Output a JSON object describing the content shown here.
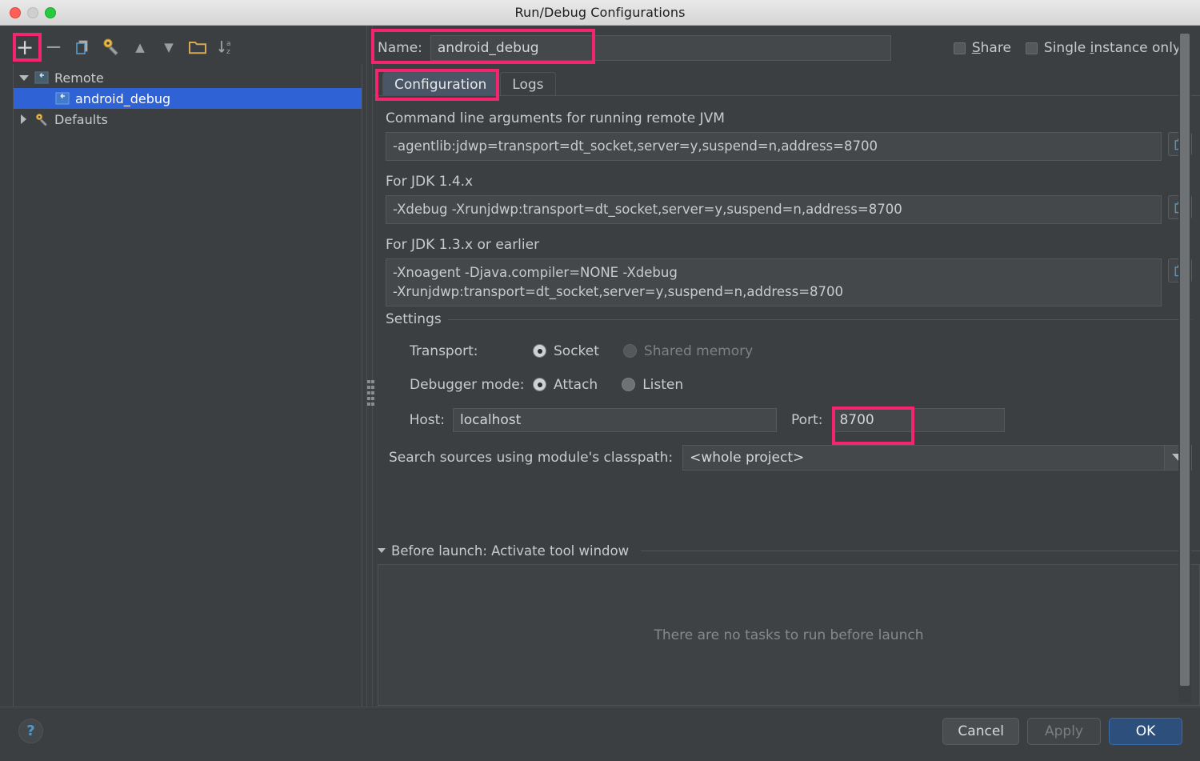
{
  "window": {
    "title": "Run/Debug Configurations",
    "traffic_lights": [
      "close-red",
      "minimize-yellow",
      "zoom-green"
    ]
  },
  "accents": {
    "highlight": "#f4246e",
    "selection": "#2f62d4",
    "primary_button": "#2d4f7c",
    "panel_bg": "#3c3f41",
    "input_bg": "#45484a"
  },
  "left_toolbar": {
    "buttons": [
      {
        "name": "add",
        "icon": "plus-icon",
        "glyph": "+",
        "highlighted": true
      },
      {
        "name": "remove",
        "icon": "minus-icon",
        "glyph": "−",
        "highlighted": false
      },
      {
        "name": "copy",
        "icon": "copy-icon",
        "glyph": "",
        "highlighted": false
      },
      {
        "name": "edit-defaults",
        "icon": "wrench-icon",
        "glyph": "",
        "highlighted": false
      },
      {
        "name": "move-up",
        "icon": "arrow-up-icon",
        "glyph": "▲",
        "highlighted": false
      },
      {
        "name": "move-down",
        "icon": "arrow-down-icon",
        "glyph": "▼",
        "highlighted": false
      },
      {
        "name": "new-folder",
        "icon": "folder-icon",
        "glyph": "",
        "highlighted": false
      },
      {
        "name": "sort-alphabetically",
        "icon": "sort-az-icon",
        "glyph": "",
        "highlighted": false
      }
    ]
  },
  "tree": {
    "nodes": [
      {
        "label": "Remote",
        "expander": "down",
        "icon": "remote-config-icon",
        "indent": false,
        "selected": false
      },
      {
        "label": "android_debug",
        "expander": "blank",
        "icon": "remote-config-icon",
        "indent": true,
        "selected": true
      },
      {
        "label": "Defaults",
        "expander": "right",
        "icon": "wrench-icon",
        "indent": false,
        "selected": false
      }
    ]
  },
  "name_row": {
    "label": "Name:",
    "value": "android_debug",
    "share": {
      "label_before": "",
      "underlined": "S",
      "label_after": "hare",
      "checked": false
    },
    "single_instance": {
      "label_before": "Single ",
      "underlined": "i",
      "label_after": "nstance only",
      "checked": false
    }
  },
  "tabs": [
    {
      "label": "Configuration",
      "active": true,
      "highlighted": true
    },
    {
      "label": "Logs",
      "active": false,
      "highlighted": false
    }
  ],
  "configuration": {
    "cmdline": {
      "label": "Command line arguments for running remote JVM",
      "value": "-agentlib:jdwp=transport=dt_socket,server=y,suspend=n,address=8700",
      "copy_icon": "copy-icon"
    },
    "jdk14": {
      "label": "For JDK 1.4.x",
      "value": "-Xdebug -Xrunjdwp:transport=dt_socket,server=y,suspend=n,address=8700",
      "copy_icon": "copy-icon"
    },
    "jdk13": {
      "label": "For JDK 1.3.x or earlier",
      "value": "-Xnoagent -Djava.compiler=NONE -Xdebug\n-Xrunjdwp:transport=dt_socket,server=y,suspend=n,address=8700",
      "copy_icon": "copy-icon"
    },
    "settings": {
      "legend": "Settings",
      "transport": {
        "label": "Transport:",
        "options": [
          {
            "label": "Socket",
            "selected": true,
            "disabled": false
          },
          {
            "label": "Shared memory",
            "selected": false,
            "disabled": true
          }
        ]
      },
      "debugger_mode": {
        "label": "Debugger mode:",
        "options": [
          {
            "label": "Attach",
            "selected": true,
            "disabled": false
          },
          {
            "label": "Listen",
            "selected": false,
            "disabled": false
          }
        ]
      },
      "host": {
        "label": "Host:",
        "value": "localhost"
      },
      "port": {
        "label": "Port:",
        "value": "8700",
        "highlighted": true
      },
      "search_sources": {
        "label": "Search sources using module's classpath:",
        "value": "<whole project>",
        "arrow_icon": "chevron-down-icon"
      }
    }
  },
  "before_launch": {
    "expander": "chevron-down-icon",
    "title": "Before launch: Activate tool window",
    "empty_text": "There are no tasks to run before launch",
    "toolbar": [
      {
        "name": "add-task",
        "icon": "plus-icon",
        "glyph": "+"
      },
      {
        "name": "remove-task",
        "icon": "minus-icon",
        "glyph": "−"
      },
      {
        "name": "edit-task",
        "icon": "pencil-icon",
        "glyph": ""
      },
      {
        "name": "move-task-up",
        "icon": "arrow-up-icon",
        "glyph": "▲"
      },
      {
        "name": "move-task-down",
        "icon": "arrow-down-icon",
        "glyph": "▼"
      }
    ]
  },
  "footer": {
    "help": "?",
    "cancel": "Cancel",
    "apply": "Apply",
    "ok": "OK"
  }
}
